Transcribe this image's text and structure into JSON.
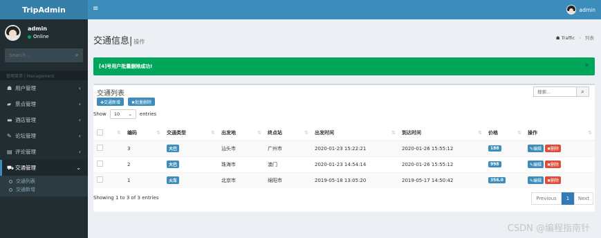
{
  "app": {
    "title": "TripAdmin"
  },
  "user": {
    "name": "admin",
    "status": "Online"
  },
  "sidebar": {
    "search_placeholder": "Search...",
    "menu_header": "管理菜单 | Management",
    "items": [
      {
        "label": "用户管理",
        "icon": "users-icon"
      },
      {
        "label": "景点管理",
        "icon": "book-icon"
      },
      {
        "label": "酒店管理",
        "icon": "bed-icon"
      },
      {
        "label": "论坛管理",
        "icon": "forum-icon"
      },
      {
        "label": "评论管理",
        "icon": "comment-icon"
      },
      {
        "label": "交通管理",
        "icon": "car-icon"
      }
    ],
    "submenu": [
      "交通列表",
      "交通新增"
    ]
  },
  "header": {
    "menu_icon": "≡",
    "user": "admin"
  },
  "page": {
    "title": "交通信息",
    "subtitle": "操作"
  },
  "breadcrumb": {
    "root": "Traffic",
    "current": "列表"
  },
  "alert": {
    "message": "[4]号用户批量删除成功!",
    "close": "×"
  },
  "box": {
    "title": "交通列表",
    "search_placeholder": "搜索...",
    "add_button": "✚交通新增",
    "batch_delete_button": "✖批量删除",
    "show_label": "Show",
    "page_size": "10",
    "entries_label": "entries"
  },
  "table": {
    "columns": [
      "编码",
      "交通类型",
      "出发地",
      "终点站",
      "出发时间",
      "到达时间",
      "价格",
      "操作"
    ],
    "rows": [
      {
        "id": "3",
        "type": "大巴",
        "from": "汕头市",
        "to": "广州市",
        "depart": "2020-01-23 15:22:21",
        "arrive": "2020-01-26 15:55:12",
        "price": "188"
      },
      {
        "id": "2",
        "type": "大巴",
        "from": "珠海市",
        "to": "澳门",
        "depart": "2020-01-23 14:54:14",
        "arrive": "2020-01-26 15:55:12",
        "price": "998"
      },
      {
        "id": "1",
        "type": "火车",
        "from": "北京市",
        "to": "绵阳市",
        "depart": "2019-05-18 13:05:20",
        "arrive": "2019-05-17 14:50:42",
        "price": "356.0"
      }
    ],
    "edit_label": "✎编辑",
    "delete_label": "✖删除"
  },
  "footer": {
    "info": "Showing 1 to 3 of 3 entries",
    "prev": "Previous",
    "current_page": "1",
    "next": "Next"
  },
  "watermark": "CSDN @编程指南针",
  "colors": {
    "brand": "#3c8dbc",
    "sidebar": "#222d32",
    "success": "#00a65a",
    "danger": "#dd4b39"
  }
}
